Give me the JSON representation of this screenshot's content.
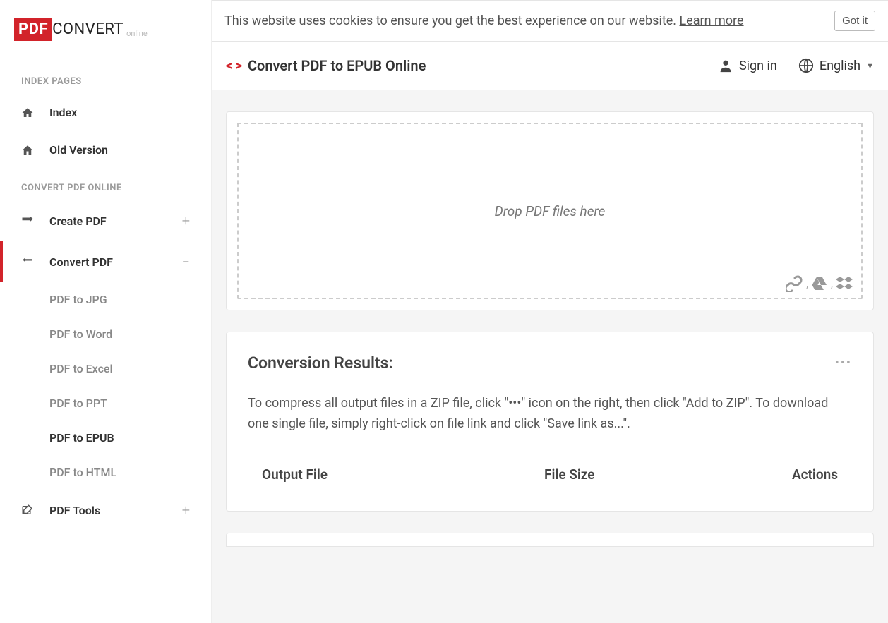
{
  "logo": {
    "pdf": "PDF",
    "convert": "CONVERT",
    "online": "online"
  },
  "sidebar": {
    "section_index": "INDEX PAGES",
    "index": "Index",
    "old_version": "Old Version",
    "section_convert": "CONVERT PDF ONLINE",
    "create_pdf": "Create PDF",
    "convert_pdf": "Convert PDF",
    "pdf_to_jpg": "PDF to JPG",
    "pdf_to_word": "PDF to Word",
    "pdf_to_excel": "PDF to Excel",
    "pdf_to_ppt": "PDF to PPT",
    "pdf_to_epub": "PDF to EPUB",
    "pdf_to_html": "PDF to HTML",
    "pdf_tools": "PDF Tools",
    "plus": "+",
    "minus": "−"
  },
  "cookie": {
    "text": "This website uses cookies to ensure you get the best experience on our website. ",
    "learn_more": "Learn more",
    "got_it": "Got it"
  },
  "topbar": {
    "title": "Convert PDF to EPUB Online",
    "sign_in": "Sign in",
    "language": "English"
  },
  "dropzone": {
    "text": "Drop PDF files here",
    "sep": ","
  },
  "results": {
    "title": "Conversion Results:",
    "desc": "To compress all output files in a ZIP file, click \"•••\" icon on the right, then click \"Add to ZIP\". To download one single file, simply right-click on file link and click \"Save link as...\".",
    "col_output": "Output File",
    "col_size": "File Size",
    "col_actions": "Actions"
  }
}
